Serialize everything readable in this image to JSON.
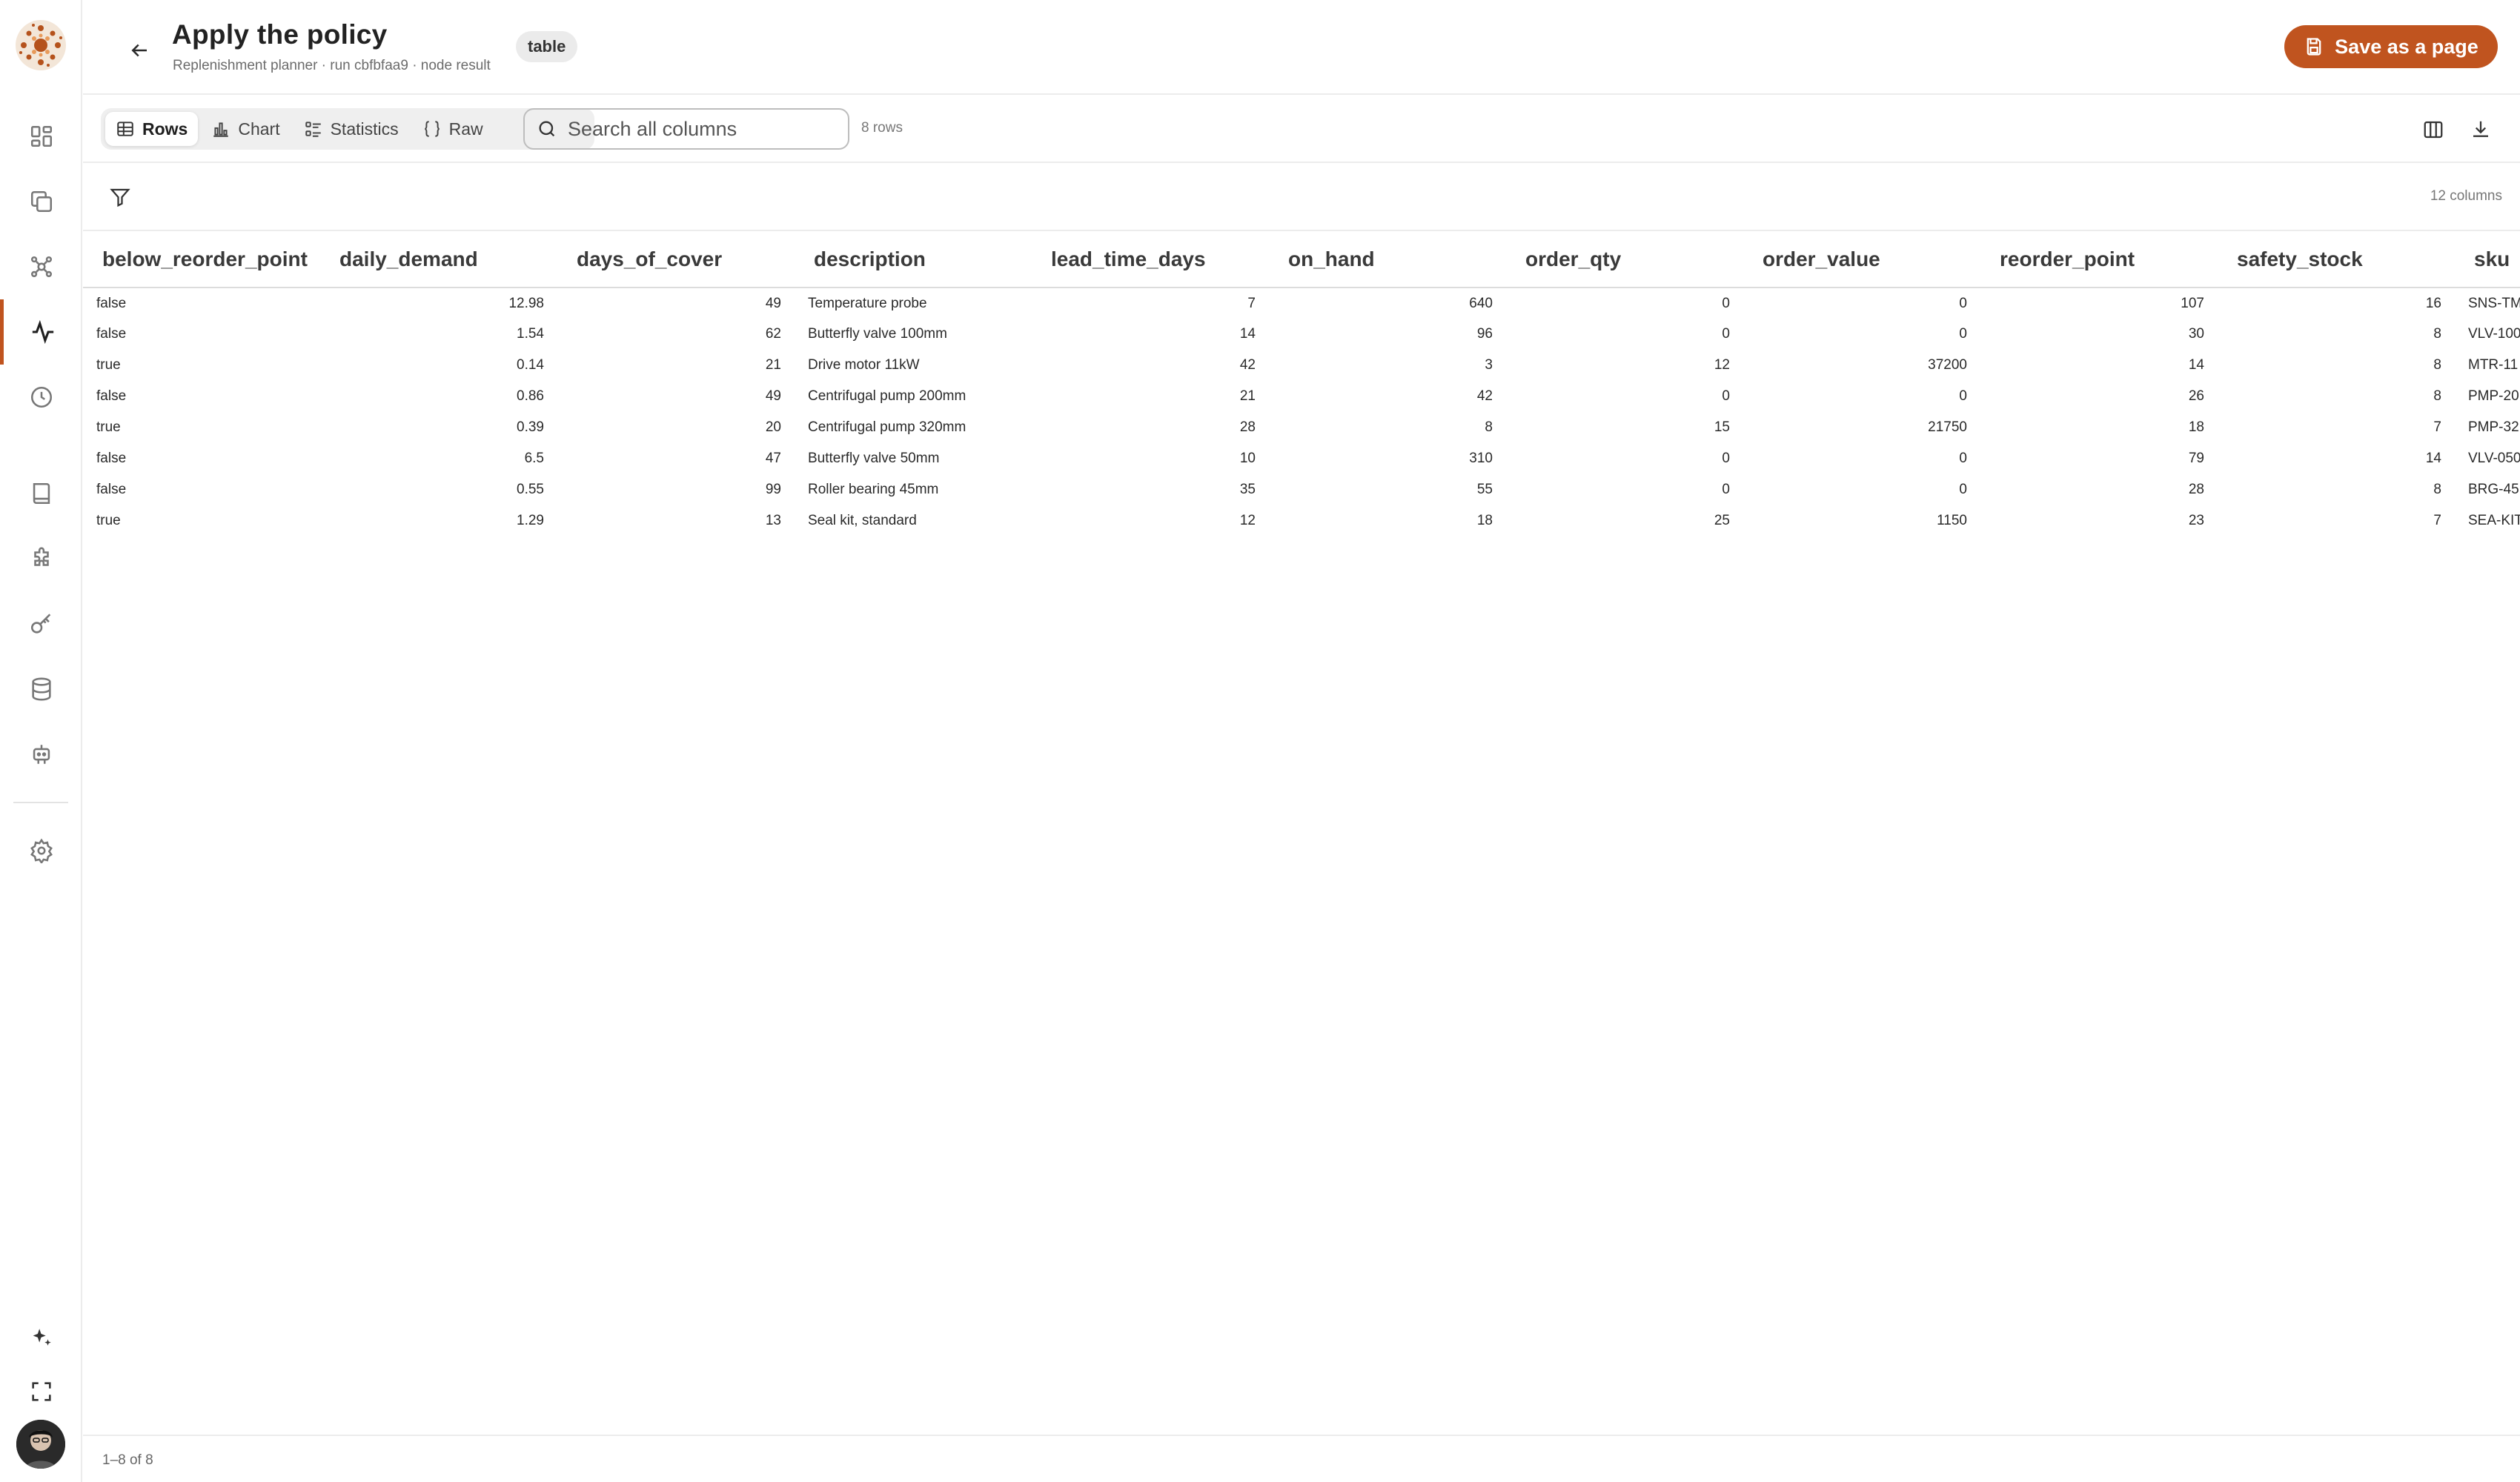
{
  "header": {
    "title": "Apply the policy",
    "subtitle": "Replenishment planner · run cbfbfaa9 · node result",
    "kind_badge": "table",
    "save_label": "Save as a page"
  },
  "toolbar": {
    "tabs": [
      {
        "label": "Rows",
        "icon": "table-icon",
        "active": true
      },
      {
        "label": "Chart",
        "icon": "bar-chart-icon",
        "active": false
      },
      {
        "label": "Statistics",
        "icon": "list-stats-icon",
        "active": false
      },
      {
        "label": "Raw",
        "icon": "braces-icon",
        "active": false
      }
    ],
    "search_placeholder": "Search all columns",
    "row_count": "8 rows"
  },
  "filterbar": {
    "column_count": "12 columns"
  },
  "table": {
    "columns": [
      "below_reorder_point",
      "daily_demand",
      "days_of_cover",
      "description",
      "lead_time_days",
      "on_hand",
      "order_qty",
      "order_value",
      "reorder_point",
      "safety_stock",
      "sku"
    ],
    "rows": [
      [
        "false",
        "12.98",
        "49",
        "Temperature probe",
        "7",
        "640",
        "0",
        "0",
        "107",
        "16",
        "SNS-TM"
      ],
      [
        "false",
        "1.54",
        "62",
        "Butterfly valve 100mm",
        "14",
        "96",
        "0",
        "0",
        "30",
        "8",
        "VLV-100"
      ],
      [
        "true",
        "0.14",
        "21",
        "Drive motor 11kW",
        "42",
        "3",
        "12",
        "37200",
        "14",
        "8",
        "MTR-11"
      ],
      [
        "false",
        "0.86",
        "49",
        "Centrifugal pump 200mm",
        "21",
        "42",
        "0",
        "0",
        "26",
        "8",
        "PMP-20"
      ],
      [
        "true",
        "0.39",
        "20",
        "Centrifugal pump 320mm",
        "28",
        "8",
        "15",
        "21750",
        "18",
        "7",
        "PMP-32"
      ],
      [
        "false",
        "6.5",
        "47",
        "Butterfly valve 50mm",
        "10",
        "310",
        "0",
        "0",
        "79",
        "14",
        "VLV-050"
      ],
      [
        "false",
        "0.55",
        "99",
        "Roller bearing 45mm",
        "35",
        "55",
        "0",
        "0",
        "28",
        "8",
        "BRG-45"
      ],
      [
        "true",
        "1.29",
        "13",
        "Seal kit, standard",
        "12",
        "18",
        "25",
        "1150",
        "23",
        "7",
        "SEA-KIT"
      ]
    ]
  },
  "footer": {
    "range": "1–8 of 8"
  },
  "colors": {
    "accent": "#c0541f",
    "border": "#ececec",
    "segment_bg": "#efefef"
  }
}
